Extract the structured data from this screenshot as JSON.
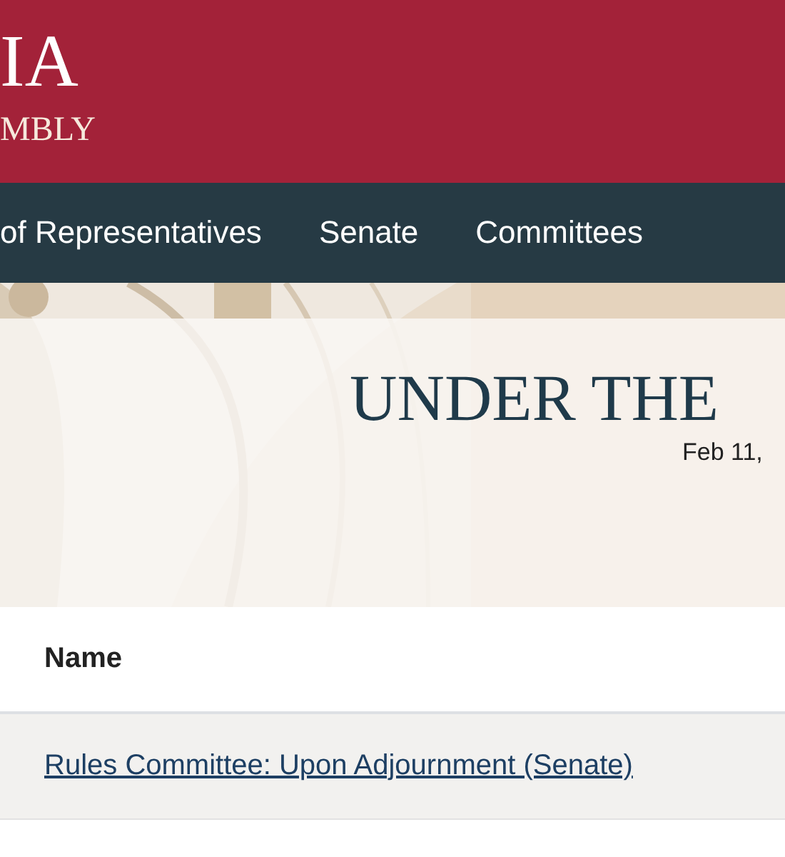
{
  "header": {
    "logo_line_1": "IA",
    "logo_line_2": "MBLY"
  },
  "nav": {
    "items": [
      {
        "label": "of Representatives"
      },
      {
        "label": "Senate"
      },
      {
        "label": "Committees"
      }
    ]
  },
  "hero": {
    "title": "UNDER THE",
    "date": "Feb 11,"
  },
  "table": {
    "columns": [
      "Name"
    ],
    "rows": [
      {
        "name": "Rules Committee: Upon Adjournment (Senate)",
        "shaded": true
      }
    ]
  }
}
